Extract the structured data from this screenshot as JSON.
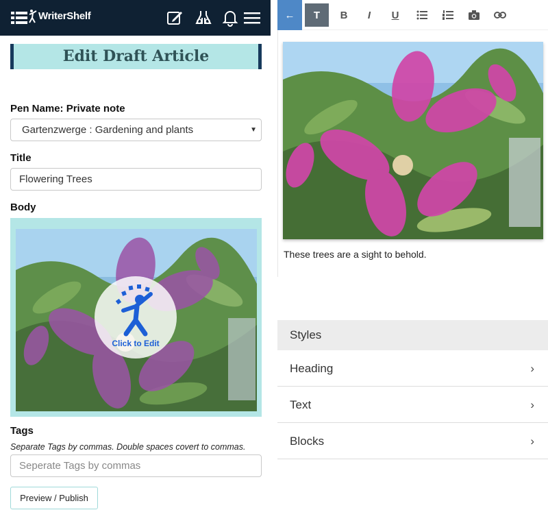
{
  "app": {
    "brand": "WriterShelf"
  },
  "editor_form": {
    "page_title": "Edit Draft Article",
    "pen_name_label": "Pen Name: Private note",
    "pen_name_value": "Gartenzwerge : Gardening and plants",
    "title_label": "Title",
    "title_value": "Flowering Trees",
    "body_label": "Body",
    "click_to_edit": "Click to Edit",
    "tags_label": "Tags",
    "tags_hint": "Separate Tags by commas. Double spaces covert to commas.",
    "tags_placeholder": "Seperate Tags by commas",
    "preview_button": "Preview / Publish"
  },
  "toolbar": {
    "back": "←",
    "text": "T",
    "bold": "B",
    "italic": "I",
    "underline": "U"
  },
  "editor": {
    "caption": "These trees are a sight to behold."
  },
  "styles_panel": {
    "header": "Styles",
    "items": [
      {
        "label": "Heading"
      },
      {
        "label": "Text"
      },
      {
        "label": "Blocks"
      }
    ]
  },
  "colors": {
    "topbar": "#0f2133",
    "accent_cyan": "#b4e6e6",
    "toolbar_back": "#4e88c7",
    "toolbar_active": "#5f6b76"
  }
}
